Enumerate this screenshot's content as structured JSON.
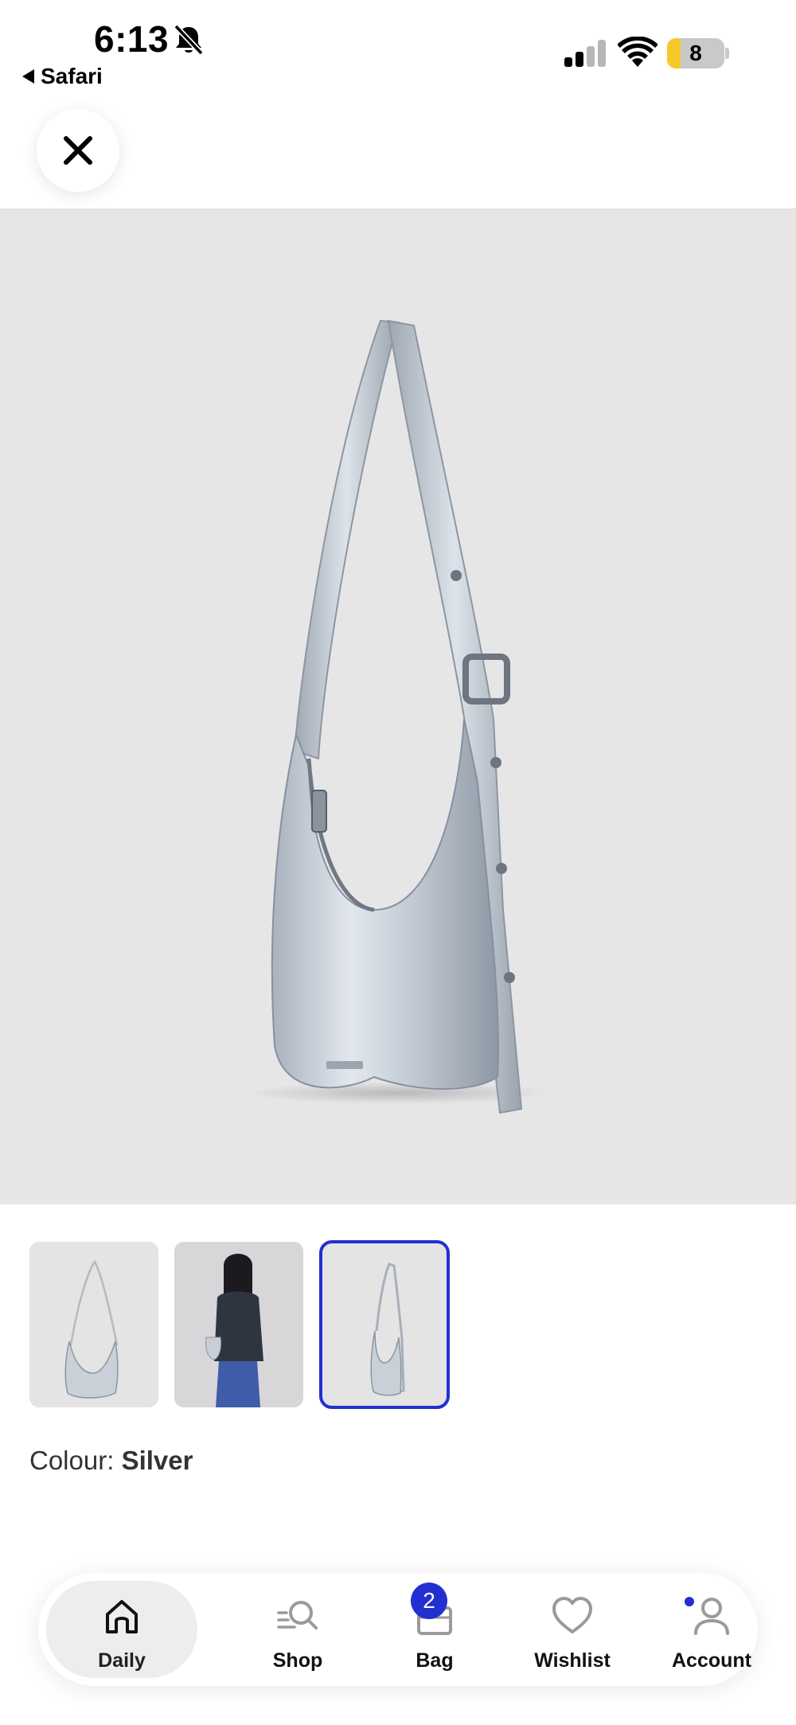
{
  "status_bar": {
    "time": "6:13",
    "back_app": "Safari",
    "battery_percent": "8",
    "battery_level": 0.08
  },
  "gallery": {
    "selected_index": 2,
    "thumbnail_count": 3
  },
  "product": {
    "colour_label": "Colour:",
    "colour_value": "Silver"
  },
  "nav": {
    "items": [
      {
        "label": "Daily",
        "icon": "home-icon",
        "active": true
      },
      {
        "label": "Shop",
        "icon": "search-icon"
      },
      {
        "label": "Bag",
        "icon": "bag-icon",
        "badge": "2"
      },
      {
        "label": "Wishlist",
        "icon": "heart-icon"
      },
      {
        "label": "Account",
        "icon": "person-icon"
      }
    ]
  },
  "colors": {
    "accent": "#2230d1",
    "hero_background": "#e6e6e7",
    "battery_low": "#f6c928"
  }
}
